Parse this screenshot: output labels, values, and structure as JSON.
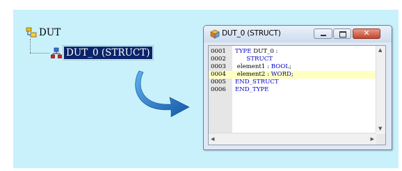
{
  "tree": {
    "root_label": "DUT",
    "child_label": "DUT_0 (STRUCT)"
  },
  "window": {
    "title": "DUT_0 (STRUCT)",
    "close_glyph": "✕"
  },
  "code_lines": [
    {
      "num": "0001",
      "text": "TYPE DUT_0 :",
      "highlight": false
    },
    {
      "num": "0002",
      "text": "      STRUCT",
      "highlight": false
    },
    {
      "num": "0003",
      "text": " element1 : BOOL;",
      "highlight": false
    },
    {
      "num": "0004",
      "text": " element2 : WORD;",
      "highlight": true
    },
    {
      "num": "0005",
      "text": "END_STRUCT",
      "highlight": false
    },
    {
      "num": "0006",
      "text": "END_TYPE",
      "highlight": false
    }
  ],
  "colors": {
    "panel_background": "#c9f1fb",
    "selection": "#0a246a",
    "keyword": "#0000c8",
    "highlight_line": "#ffffc0",
    "arrow": "#1f77c8"
  },
  "icons": {
    "tree_root": "folder-tree-icon",
    "tree_child": "struct-icon",
    "window": "cube-icon",
    "arrow": "curved-arrow-icon"
  }
}
